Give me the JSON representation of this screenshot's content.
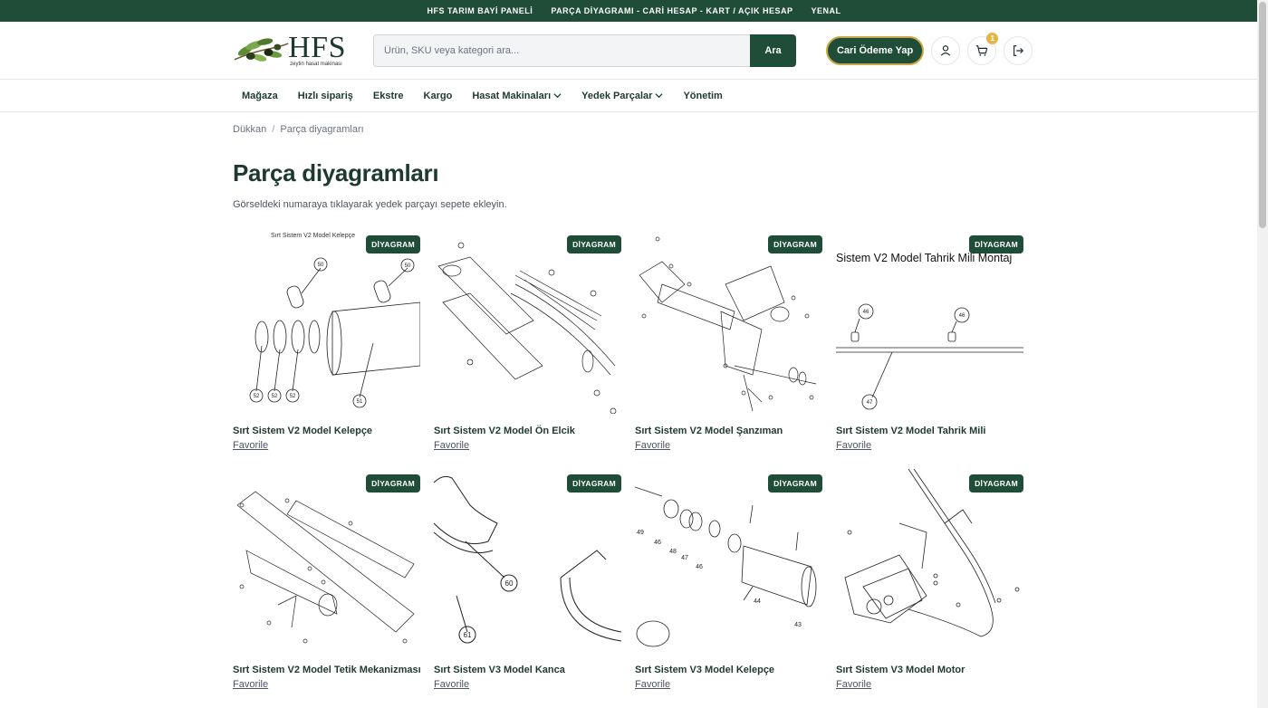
{
  "topbar": {
    "links": [
      "HFS TARIM BAYİ PANELİ",
      "PARÇA DİYAGRAMI - CARİ HESAP - KART / AÇIK HESAP",
      "YENAL"
    ]
  },
  "header": {
    "logo_text": "HFS",
    "logo_subtext": "zeytin hasat makinası",
    "search_placeholder": "Ürün, SKU veya kategori ara...",
    "search_button": "Ara",
    "pay_button": "Cari Ödeme Yap",
    "cart_count": "1"
  },
  "nav": {
    "items": [
      "Mağaza",
      "Hızlı sipariş",
      "Ekstre",
      "Kargo",
      "Hasat Makinaları",
      "Yedek Parçalar",
      "Yönetim"
    ]
  },
  "breadcrumb": {
    "home": "Dükkan",
    "separator": "/",
    "current": "Parça diyagramları"
  },
  "page": {
    "title": "Parça diyagramları",
    "description": "Görseldeki numaraya tıklayarak yedek parçayı sepete ekleyin."
  },
  "cards": [
    {
      "name": "Sırt Sistem V2 Model Kelepçe",
      "badge": "DİYAGRAM",
      "fav": "Favorile",
      "diagram_caption": "Sırt Sistem V2 Model Kelepçe"
    },
    {
      "name": "Sırt Sistem V2 Model Ön Elcik",
      "badge": "DİYAGRAM",
      "fav": "Favorile",
      "diagram_caption": ""
    },
    {
      "name": "Sırt Sistem V2 Model Şanzıman",
      "badge": "DİYAGRAM",
      "fav": "Favorile",
      "diagram_caption": ""
    },
    {
      "name": "Sırt Sistem V2 Model Tahrik Mili",
      "badge": "DİYAGRAM",
      "fav": "Favorile",
      "diagram_caption": "Sistem V2 Model Tahrik Mili Montaj"
    },
    {
      "name": "Sırt Sistem V2 Model Tetik Mekanizması",
      "badge": "DİYAGRAM",
      "fav": "Favorile",
      "diagram_caption": ""
    },
    {
      "name": "Sırt Sistem V3 Model Kanca",
      "badge": "DİYAGRAM",
      "fav": "Favorile",
      "diagram_caption": ""
    },
    {
      "name": "Sırt Sistem V3 Model Kelepçe",
      "badge": "DİYAGRAM",
      "fav": "Favorile",
      "diagram_caption": ""
    },
    {
      "name": "Sırt Sistem V3 Model Motor",
      "badge": "DİYAGRAM",
      "fav": "Favorile",
      "diagram_caption": ""
    }
  ],
  "diagram_labels": {
    "card1": [
      "50",
      "50",
      "52",
      "52",
      "52",
      "51"
    ],
    "card4": [
      "46",
      "46",
      "47"
    ],
    "card6": [
      "60",
      "61"
    ],
    "card7": [
      "49",
      "46",
      "48",
      "47",
      "46",
      "44",
      "43"
    ]
  },
  "colors": {
    "brand_green": "#1f4d38",
    "accent_gold": "#c9a84a",
    "badge_gold": "#e0b84a"
  },
  "icons": {
    "user": "user-icon",
    "cart": "cart-icon",
    "logout": "logout-icon",
    "chevron": "chevron-down-icon"
  }
}
